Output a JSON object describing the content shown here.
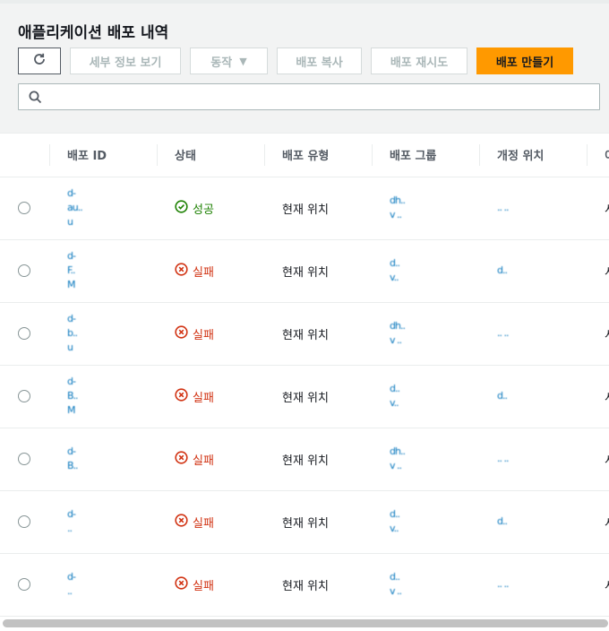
{
  "page": {
    "title": "애플리케이션 배포 내역"
  },
  "toolbar": {
    "refresh_icon": "refresh-icon",
    "details": "세부 정보 보기",
    "actions": "동작",
    "copy": "배포 복사",
    "retry": "배포 재시도",
    "create": "배포 만들기"
  },
  "search": {
    "placeholder": "",
    "icon": "search-icon"
  },
  "columns": [
    "",
    "배포 ID",
    "상태",
    "배포 유형",
    "배포 그룹",
    "개정 위치",
    "이"
  ],
  "rows": [
    {
      "id": "d-\nau..\nu",
      "status": "성공",
      "status_kind": "ok",
      "type": "현재 위치",
      "group": "dh..\nv ..",
      "revision": ".. ..",
      "extra": "시"
    },
    {
      "id": "d-\nF..\nM",
      "status": "실패",
      "status_kind": "fail",
      "type": "현재 위치",
      "group": "d..\nv..",
      "revision": "d..",
      "extra": "시"
    },
    {
      "id": "d-\nb..\nu",
      "status": "실패",
      "status_kind": "fail",
      "type": "현재 위치",
      "group": "dh..\nv ..",
      "revision": ".. ..",
      "extra": "시"
    },
    {
      "id": "d-\nB..\nM",
      "status": "실패",
      "status_kind": "fail",
      "type": "현재 위치",
      "group": "d..\nv..",
      "revision": "d..",
      "extra": "시"
    },
    {
      "id": "d-\nB..",
      "status": "실패",
      "status_kind": "fail",
      "type": "현재 위치",
      "group": "dh..\nv ..",
      "revision": ".. ..",
      "extra": "시"
    },
    {
      "id": "d-\n..",
      "status": "실패",
      "status_kind": "fail",
      "type": "현재 위치",
      "group": "d..\nv..",
      "revision": "d..",
      "extra": "시"
    },
    {
      "id": "d-\n..",
      "status": "실패",
      "status_kind": "fail",
      "type": "현재 위치",
      "group": "d..\nv ..",
      "revision": ".. ..",
      "extra": "시"
    }
  ],
  "colors": {
    "primary": "#ff9900",
    "success": "#1d8102",
    "error": "#d13212",
    "link": "#0073bb"
  }
}
